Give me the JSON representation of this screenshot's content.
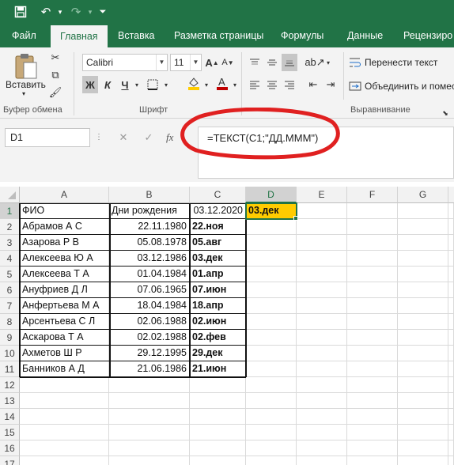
{
  "tabs": [
    "Файл",
    "Главная",
    "Вставка",
    "Разметка страницы",
    "Формулы",
    "Данные",
    "Рецензиро"
  ],
  "ribbon": {
    "paste_label": "Вставить",
    "clipboard_group": "Буфер обмена",
    "font_group": "Шрифт",
    "align_group": "Выравнивание",
    "font_name": "Calibri",
    "font_size": "11",
    "bold": "Ж",
    "italic": "К",
    "underline": "Ч",
    "wrap_text": "Перенести текст",
    "merge_center": "Объединить и помес",
    "font_color": "#c00000",
    "fill_color": "#ffcc00"
  },
  "formula_bar": {
    "name_box": "D1",
    "formula": "=ТЕКСТ(C1;\"ДД.МММ\")",
    "annotation_color": "#e02020"
  },
  "columns": [
    "A",
    "B",
    "C",
    "D",
    "E",
    "F",
    "G"
  ],
  "row_numbers": [
    "1",
    "2",
    "3",
    "4",
    "5",
    "6",
    "7",
    "8",
    "9",
    "10",
    "11",
    "12",
    "13",
    "14",
    "15",
    "16",
    "17"
  ],
  "sheet": {
    "header": {
      "a": "ФИО",
      "b": "Дни рождения",
      "c": "03.12.2020",
      "d": "03.дек"
    },
    "rows": [
      {
        "a": "Абрамов А С",
        "b": "22.11.1980",
        "c": "22.ноя"
      },
      {
        "a": "Азарова Р В",
        "b": "05.08.1978",
        "c": "05.авг"
      },
      {
        "a": "Алексеева Ю А",
        "b": "03.12.1986",
        "c": "03.дек"
      },
      {
        "a": "Алексеева Т А",
        "b": "01.04.1984",
        "c": "01.апр"
      },
      {
        "a": "Ануфриев Д Л",
        "b": "07.06.1965",
        "c": "07.июн"
      },
      {
        "a": "Анфертьева М А",
        "b": "18.04.1984",
        "c": "18.апр"
      },
      {
        "a": "Арсентьева С Л",
        "b": "02.06.1988",
        "c": "02.июн"
      },
      {
        "a": "Аскарова Т А",
        "b": "02.02.1988",
        "c": "02.фев"
      },
      {
        "a": "Ахметов Ш Р",
        "b": "29.12.1995",
        "c": "29.дек"
      },
      {
        "a": "Банников А Д",
        "b": "21.06.1986",
        "c": "21.июн"
      }
    ]
  }
}
